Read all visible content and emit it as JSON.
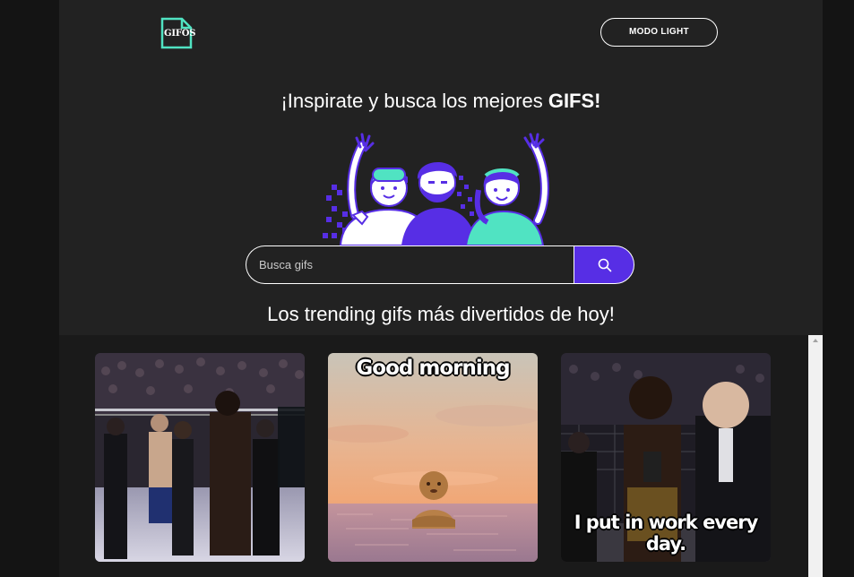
{
  "header": {
    "logo_text": "GIFOS",
    "mode_button_label": "MODO LIGHT"
  },
  "hero": {
    "title_prefix": "¡Inspirate y busca los mejores ",
    "title_highlight": "GIFS!",
    "illustration_icon": "three-people-waving-illustration"
  },
  "search": {
    "placeholder": "Busca gifs",
    "value": "",
    "button_icon": "search-icon"
  },
  "trending": {
    "title": "Los trending gifs más divertidos de hoy!"
  },
  "gifs": [
    {
      "caption": "",
      "theme": "ufc-octagon-fighters"
    },
    {
      "caption": "Good morning",
      "theme": "clay-figure-in-sea-sunset"
    },
    {
      "caption": "I put in work every day.",
      "theme": "ufc-post-fight-interview"
    }
  ],
  "colors": {
    "background": "#222222",
    "accent": "#572ee5",
    "illustration_green": "#50e3c2",
    "text": "#ffffff"
  }
}
